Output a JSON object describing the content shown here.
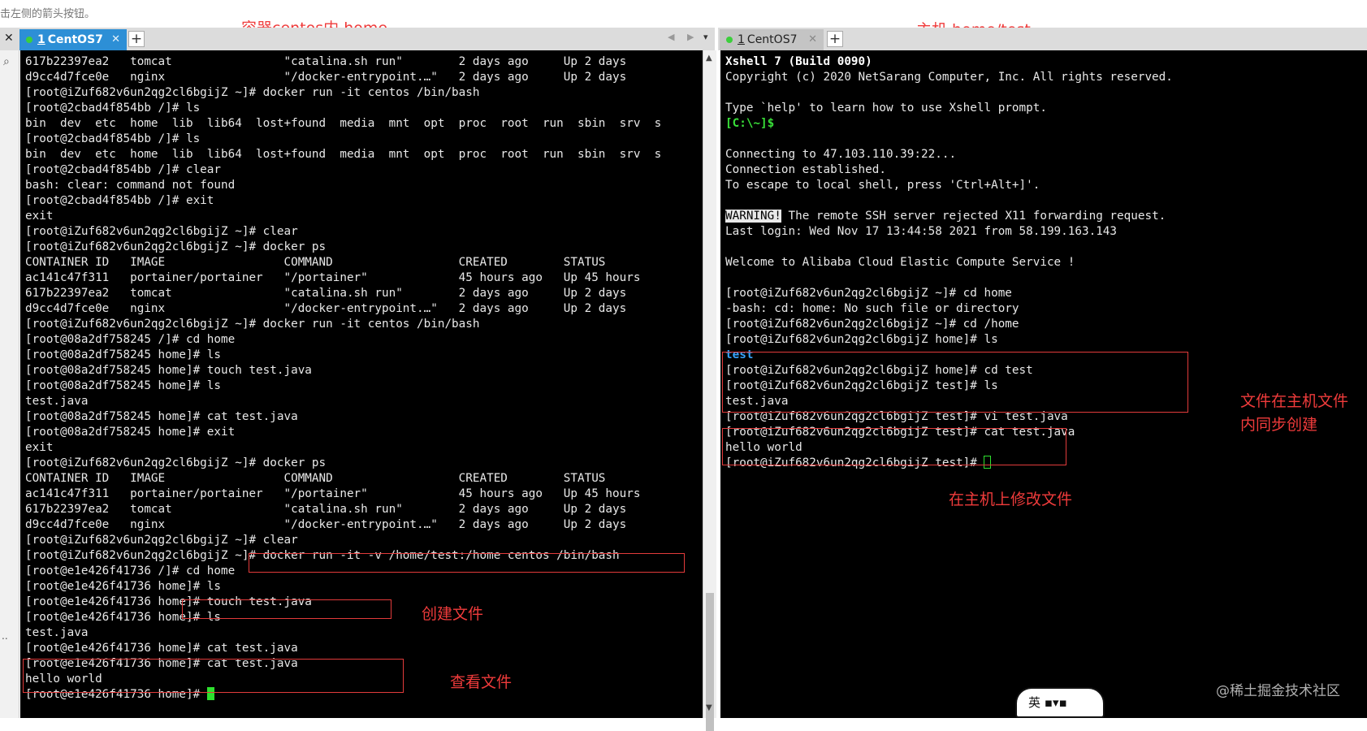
{
  "hint": "击左侧的箭头按钮。",
  "annotations": {
    "container_title": "容器centos内 home",
    "host_title": "主机 home/test",
    "sync_note": "文件在主机文件\n内同步创建",
    "modify_note": "在主机上修改文件",
    "create_note": "创建文件",
    "view_note": "查看文件"
  },
  "left_tabs": {
    "close": "✕",
    "active_number": "1",
    "active_label": "CentOS7",
    "tab_close": "✕",
    "add": "+",
    "nav": "◀ ▶",
    "dropdown": "▾"
  },
  "right_tabs": {
    "number": "1",
    "label": "CentOS7",
    "tab_close": "✕",
    "add": "+"
  },
  "scroll": {
    "up": "▲",
    "down": "▼"
  },
  "left_terminal": [
    "617b22397ea2   tomcat                \"catalina.sh run\"        2 days ago     Up 2 days",
    "d9cc4d7fce0e   nginx                 \"/docker-entrypoint.…\"   2 days ago     Up 2 days",
    "[root@iZuf682v6un2qg2cl6bgijZ ~]# docker run -it centos /bin/bash",
    "[root@2cbad4f854bb /]# ls",
    "bin  dev  etc  home  lib  lib64  lost+found  media  mnt  opt  proc  root  run  sbin  srv  s",
    "[root@2cbad4f854bb /]# ls",
    "bin  dev  etc  home  lib  lib64  lost+found  media  mnt  opt  proc  root  run  sbin  srv  s",
    "[root@2cbad4f854bb /]# clear",
    "bash: clear: command not found",
    "[root@2cbad4f854bb /]# exit",
    "exit",
    "[root@iZuf682v6un2qg2cl6bgijZ ~]# clear",
    "[root@iZuf682v6un2qg2cl6bgijZ ~]# docker ps",
    "CONTAINER ID   IMAGE                 COMMAND                  CREATED        STATUS",
    "ac141c47f311   portainer/portainer   \"/portainer\"             45 hours ago   Up 45 hours",
    "617b22397ea2   tomcat                \"catalina.sh run\"        2 days ago     Up 2 days",
    "d9cc4d7fce0e   nginx                 \"/docker-entrypoint.…\"   2 days ago     Up 2 days",
    "[root@iZuf682v6un2qg2cl6bgijZ ~]# docker run -it centos /bin/bash",
    "[root@08a2df758245 /]# cd home",
    "[root@08a2df758245 home]# ls",
    "[root@08a2df758245 home]# touch test.java",
    "[root@08a2df758245 home]# ls",
    "test.java",
    "[root@08a2df758245 home]# cat test.java",
    "[root@08a2df758245 home]# exit",
    "exit",
    "[root@iZuf682v6un2qg2cl6bgijZ ~]# docker ps",
    "CONTAINER ID   IMAGE                 COMMAND                  CREATED        STATUS",
    "ac141c47f311   portainer/portainer   \"/portainer\"             45 hours ago   Up 45 hours",
    "617b22397ea2   tomcat                \"catalina.sh run\"        2 days ago     Up 2 days",
    "d9cc4d7fce0e   nginx                 \"/docker-entrypoint.…\"   2 days ago     Up 2 days",
    "[root@iZuf682v6un2qg2cl6bgijZ ~]# clear",
    "[root@iZuf682v6un2qg2cl6bgijZ ~]# docker run -it -v /home/test:/home centos /bin/bash",
    "[root@e1e426f41736 /]# cd home",
    "[root@e1e426f41736 home]# ls",
    "[root@e1e426f41736 home]# touch test.java",
    "[root@e1e426f41736 home]# ls",
    "test.java",
    "[root@e1e426f41736 home]# cat test.java",
    "[root@e1e426f41736 home]# cat test.java",
    "hello world",
    "[root@e1e426f41736 home]# "
  ],
  "right_terminal": {
    "banner_title": "Xshell 7 (Build 0090)",
    "copyright": "Copyright (c) 2020 NetSarang Computer, Inc. All rights reserved.",
    "help_tip": "Type `help' to learn how to use Xshell prompt.",
    "local_prompt": "[C:\\~]$",
    "connecting": "Connecting to 47.103.110.39:22...",
    "established": "Connection established.",
    "escape_tip": "To escape to local shell, press 'Ctrl+Alt+]'.",
    "warning_label": "WARNING!",
    "warning_text": " The remote SSH server rejected X11 forwarding request.",
    "last_login": "Last login: Wed Nov 17 13:44:58 2021 from 58.199.163.143",
    "welcome": "Welcome to Alibaba Cloud Elastic Compute Service !",
    "lines": [
      "[root@iZuf682v6un2qg2cl6bgijZ ~]# cd home",
      "-bash: cd: home: No such file or directory",
      "[root@iZuf682v6un2qg2cl6bgijZ ~]# cd /home",
      "[root@iZuf682v6un2qg2cl6bgijZ home]# ls",
      "test",
      "[root@iZuf682v6un2qg2cl6bgijZ home]# cd test",
      "[root@iZuf682v6un2qg2cl6bgijZ test]# ls",
      "test.java",
      "[root@iZuf682v6un2qg2cl6bgijZ test]# vi test.java",
      "[root@iZuf682v6un2qg2cl6bgijZ test]# cat test.java",
      "hello world",
      "[root@iZuf682v6un2qg2cl6bgijZ test]# "
    ]
  },
  "watermark": "@稀土掘金技术社区",
  "ime_label": "英"
}
